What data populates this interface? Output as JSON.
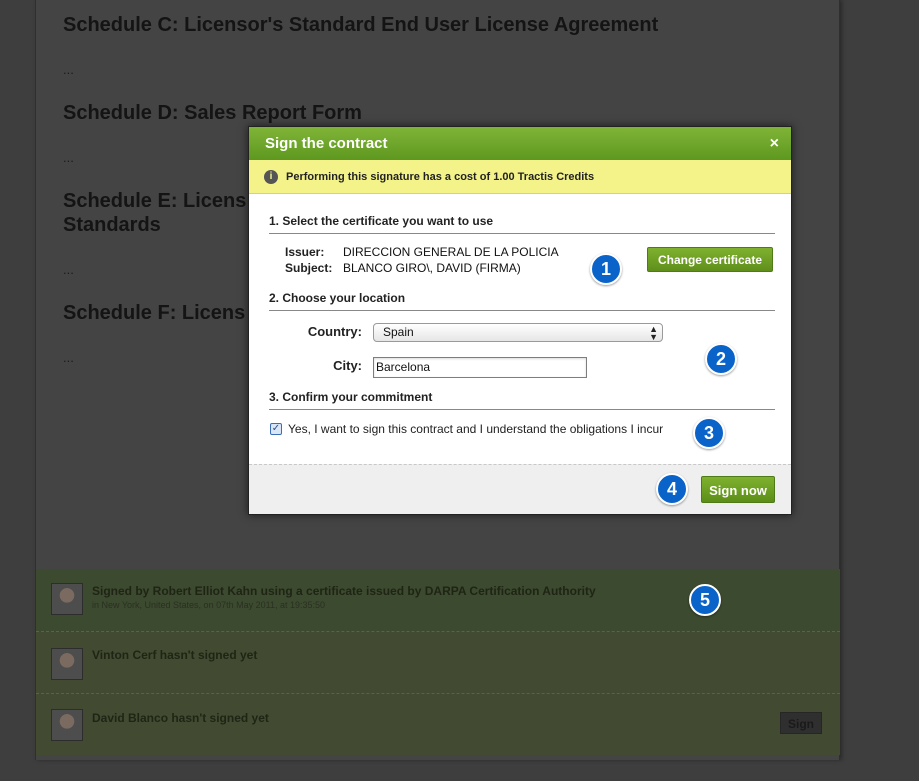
{
  "background": {
    "schedules": [
      "Schedule C: Licensor's Standard End User License Agreement",
      "Schedule D: Sales Report Form",
      "Schedule E: Licens",
      "Standards",
      "Schedule F: Licens"
    ],
    "ellipsis": "...",
    "signers": [
      {
        "name": "Signed by Robert Elliot Kahn using a certificate issued by DARPA Certification Authority",
        "detail": "in New York, United States, on 07th May 2011, at 19:35:50"
      },
      {
        "name": "Vinton Cerf hasn't signed yet"
      },
      {
        "name": "David Blanco hasn't signed yet"
      }
    ],
    "sign_button": "Sign"
  },
  "modal": {
    "title": "Sign the contract",
    "close": "×",
    "notice_icon": "i",
    "notice": "Performing this signature has a cost of 1.00 Tractis Credits",
    "step1_title": "1. Select the certificate you want to use",
    "issuer_label": "Issuer:",
    "issuer_value": "DIRECCION GENERAL DE LA POLICIA",
    "subject_label": "Subject:",
    "subject_value": "BLANCO GIRO\\, DAVID (FIRMA)",
    "change_certificate": "Change certificate",
    "step2_title": "2. Choose your location",
    "country_label": "Country:",
    "country_value": "Spain",
    "city_label": "City:",
    "city_value": "Barcelona",
    "step3_title": "3. Confirm your commitment",
    "commitment_text": "Yes, I want to sign this contract and I understand the obligations I incur",
    "commitment_checked": true,
    "sign_now": "Sign now"
  },
  "steps": [
    "1",
    "2",
    "3",
    "4",
    "5"
  ],
  "colors": {
    "accent_green": "#6ea52a",
    "notice_yellow": "#f4f38a",
    "step_blue": "#0a63c9"
  }
}
